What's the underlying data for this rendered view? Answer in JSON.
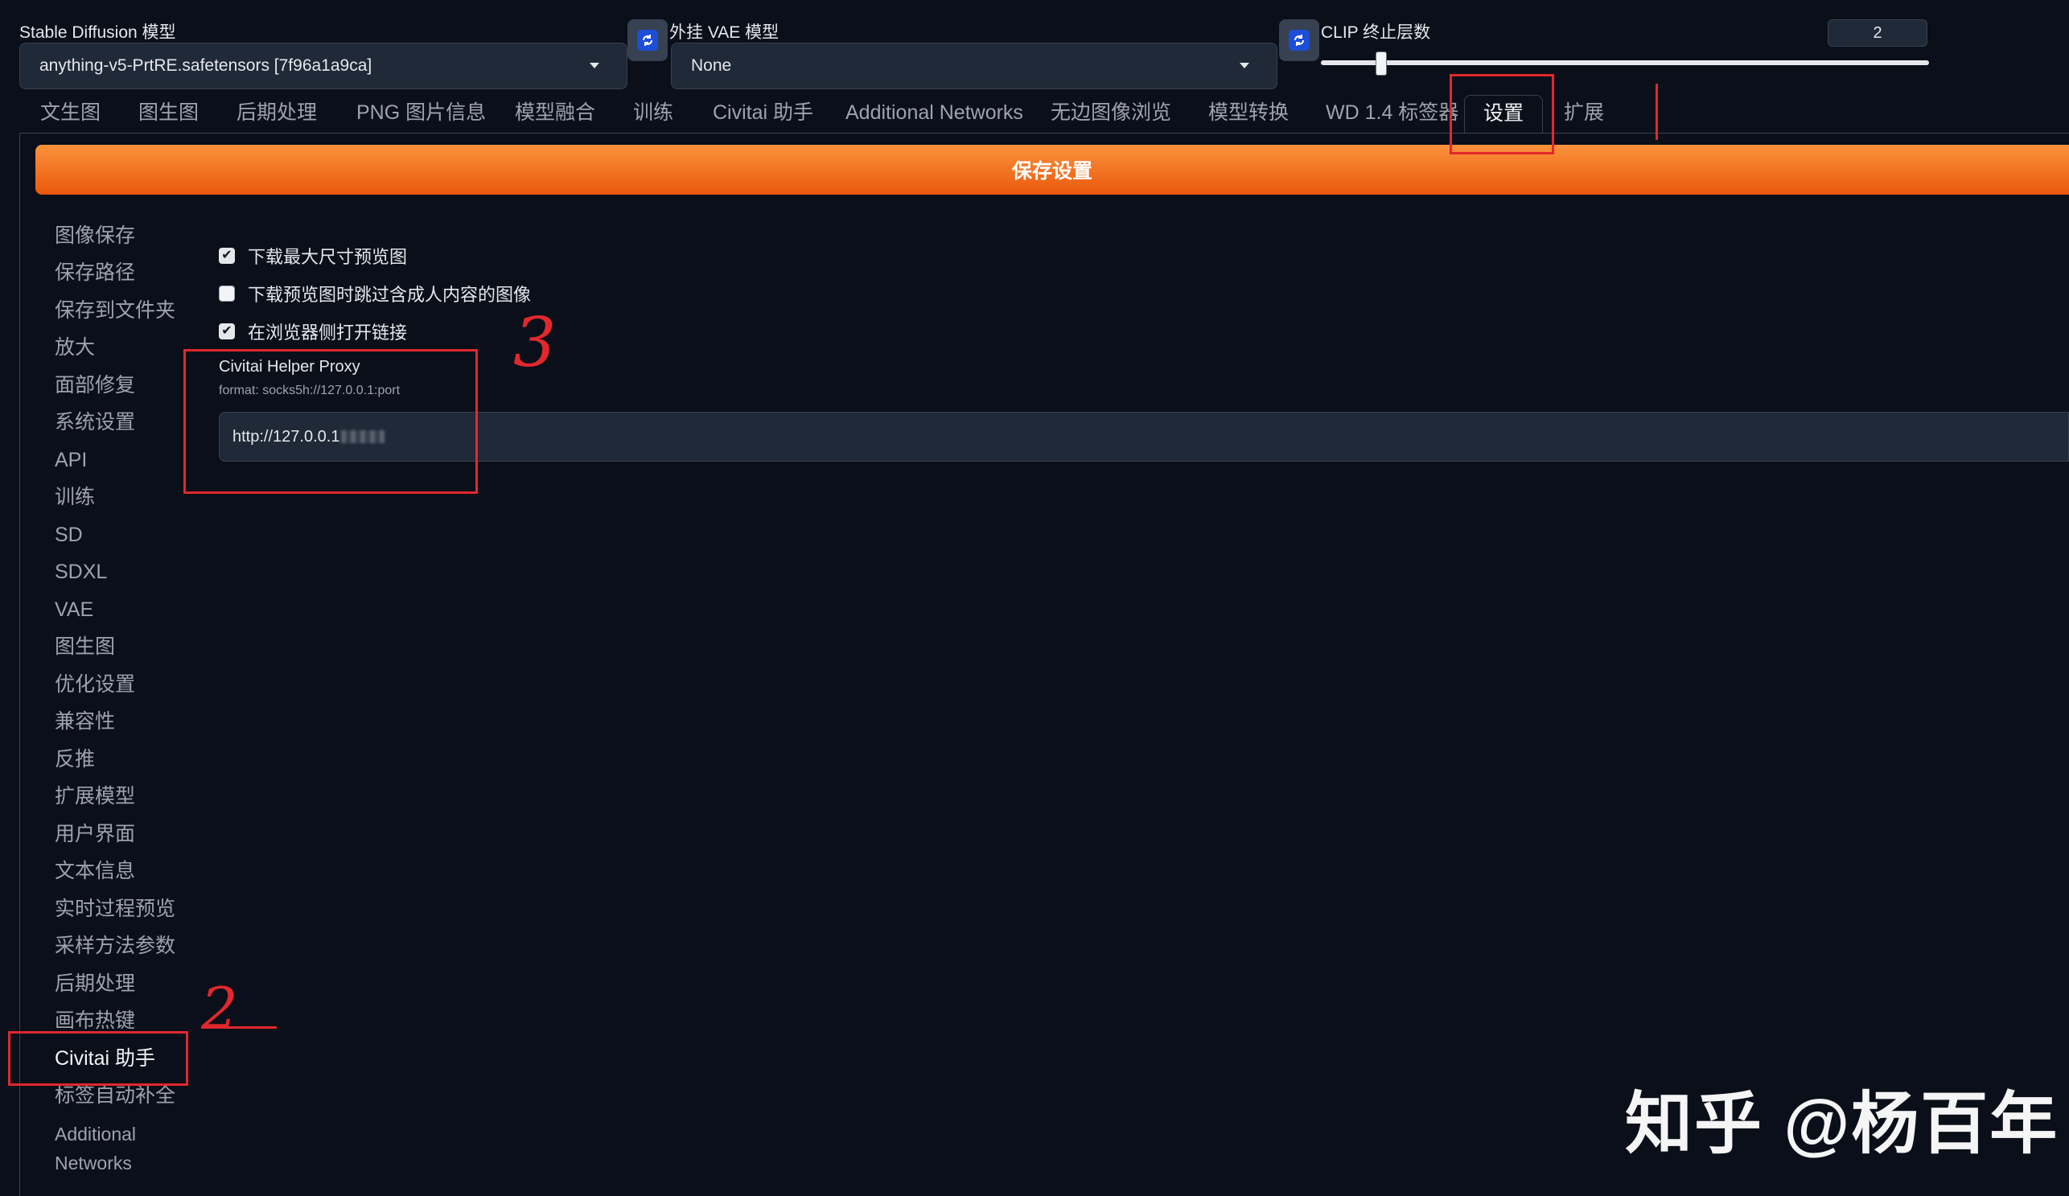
{
  "header": {
    "sd_model": {
      "label": "Stable Diffusion 模型",
      "value": "anything-v5-PrtRE.safetensors [7f96a1a9ca]"
    },
    "vae": {
      "label": "外挂 VAE 模型",
      "value": "None"
    },
    "clip": {
      "label": "CLIP 终止层数",
      "value": "2",
      "slider_fraction": 0.1
    }
  },
  "tabs": [
    "文生图",
    "图生图",
    "后期处理",
    "PNG 图片信息",
    "模型融合",
    "训练",
    "Civitai 助手",
    "Additional Networks",
    "无边图像浏览",
    "模型转换",
    "WD 1.4 标签器",
    "设置",
    "扩展"
  ],
  "active_tab": "设置",
  "save_button": "保存设置",
  "sidenav": {
    "items": [
      "图像保存",
      "保存路径",
      "保存到文件夹",
      "放大",
      "面部修复",
      "系统设置",
      "API",
      "训练",
      "SD",
      "SDXL",
      "VAE",
      "图生图",
      "优化设置",
      "兼容性",
      "反推",
      "扩展模型",
      "用户界面",
      "文本信息",
      "实时过程预览",
      "采样方法参数",
      "后期处理",
      "画布热键",
      "Civitai 助手",
      "标签自动补全",
      "Additional",
      "Networks"
    ],
    "active": "Civitai 助手"
  },
  "settings": {
    "checkboxes": [
      {
        "label": "下载最大尺寸预览图",
        "checked": true
      },
      {
        "label": "下载预览图时跳过含成人内容的图像",
        "checked": false
      },
      {
        "label": "在浏览器侧打开链接",
        "checked": true
      }
    ],
    "proxy": {
      "label": "Civitai Helper Proxy",
      "hint": "format: socks5h://127.0.0.1:port",
      "value": "http://127.0.0.1"
    }
  },
  "annotations": {
    "mark2": "2",
    "mark3": "3"
  },
  "watermark": "知乎 @杨百年",
  "colors": {
    "accent": "#f97316",
    "background": "#0b0f19",
    "annotation": "#e0282e"
  }
}
